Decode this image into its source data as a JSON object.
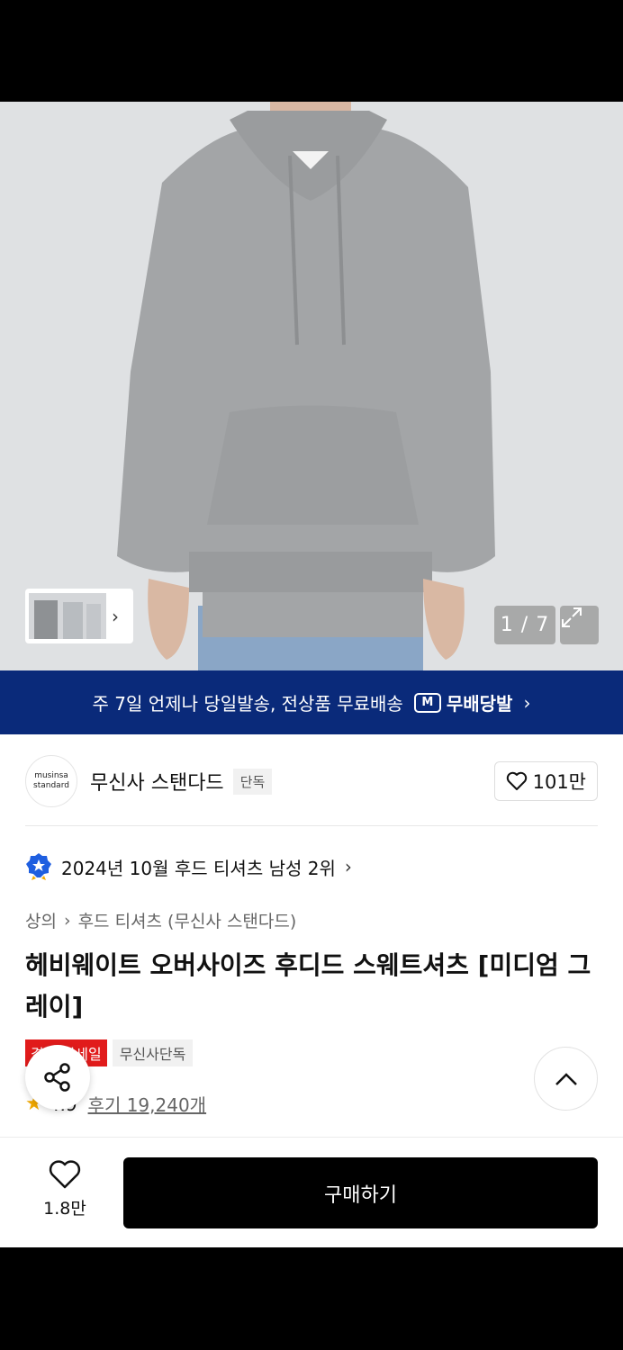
{
  "gallery": {
    "counter": "1 / 7",
    "thumb_chevron": "›",
    "expand_icon": "expand-icon"
  },
  "banner": {
    "text": "주 7일 언제나 당일발송, 전상품 무료배송",
    "logo_letter": "M",
    "badge": "무배당발",
    "chevron": "›"
  },
  "brand": {
    "logo_line1": "musinsa",
    "logo_line2": "standard",
    "name": "무신사 스탠다드",
    "tag": "단독",
    "likes": "101만"
  },
  "ranking": {
    "text": "2024년 10월 후드 티셔츠 남성 2위",
    "chevron": "›"
  },
  "breadcrumb": {
    "level1": "상의",
    "separator": "›",
    "level2": "후드 티셔츠 (무신사 스탠다드)"
  },
  "product": {
    "title": "헤비웨이트 오버사이즈 후디드 스웨트셔츠 [미디엄 그레이]",
    "badge_sale": "결산 빅세일",
    "badge_exclusive": "무신사단독",
    "rating": "4.9",
    "reviews": "후기 19,240개"
  },
  "bottom": {
    "wish_count": "1.8만",
    "buy_label": "구매하기"
  },
  "colors": {
    "banner_bg": "#0a2a7a",
    "sale_red": "#e11b1b",
    "star": "#f2a900",
    "buy_bg": "#000000"
  }
}
